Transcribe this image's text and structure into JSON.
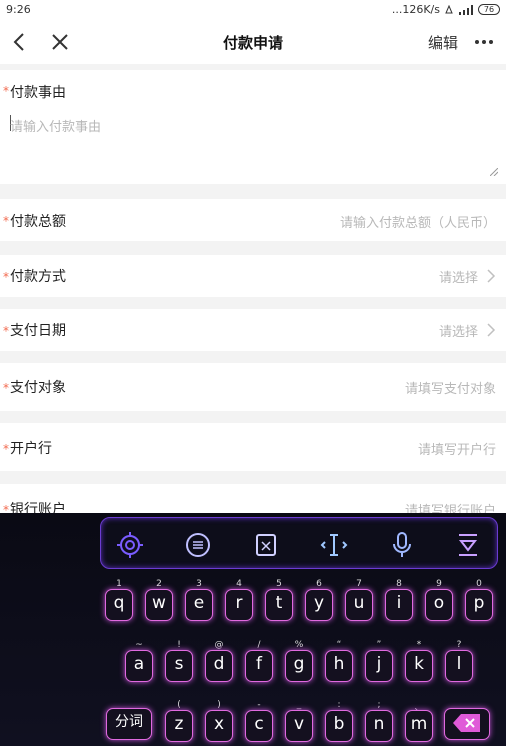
{
  "status_bar": {
    "time": "9:26",
    "speed": "...126K/s",
    "battery": "76"
  },
  "nav": {
    "title": "付款申请",
    "edit_label": "编辑",
    "back_icon": "back-arrow-icon",
    "close_icon": "close-icon",
    "more_icon": "more-icon"
  },
  "form": {
    "reason": {
      "label": "付款事由",
      "placeholder": "请输入付款事由"
    },
    "amount": {
      "label": "付款总额",
      "placeholder": "请输入付款总额（人民币）"
    },
    "method": {
      "label": "付款方式",
      "placeholder": "请选择"
    },
    "date": {
      "label": "支付日期",
      "placeholder": "请选择"
    },
    "target": {
      "label": "支付对象",
      "placeholder": "请填写支付对象"
    },
    "bank": {
      "label": "开户行",
      "placeholder": "请填写开户行"
    },
    "account": {
      "label": "银行账户",
      "placeholder": "请填写银行账户"
    }
  },
  "keyboard": {
    "toolbar": [
      "settings-icon",
      "chat-icon",
      "clipboard-icon",
      "cursor-icon",
      "mic-icon",
      "hide-keyboard-icon"
    ],
    "row1": [
      {
        "k": "q",
        "h": "1"
      },
      {
        "k": "w",
        "h": "2"
      },
      {
        "k": "e",
        "h": "3"
      },
      {
        "k": "r",
        "h": "4"
      },
      {
        "k": "t",
        "h": "5"
      },
      {
        "k": "y",
        "h": "6"
      },
      {
        "k": "u",
        "h": "7"
      },
      {
        "k": "i",
        "h": "8"
      },
      {
        "k": "o",
        "h": "9"
      },
      {
        "k": "p",
        "h": "0"
      }
    ],
    "row2": [
      {
        "k": "a",
        "h": "~"
      },
      {
        "k": "s",
        "h": "!"
      },
      {
        "k": "d",
        "h": "@"
      },
      {
        "k": "f",
        "h": "/"
      },
      {
        "k": "g",
        "h": "%"
      },
      {
        "k": "h",
        "h": "“"
      },
      {
        "k": "j",
        "h": "”"
      },
      {
        "k": "k",
        "h": "*"
      },
      {
        "k": "l",
        "h": "?"
      }
    ],
    "row3": [
      {
        "k": "z",
        "h": "("
      },
      {
        "k": "x",
        "h": ")"
      },
      {
        "k": "c",
        "h": "-"
      },
      {
        "k": "v",
        "h": "_"
      },
      {
        "k": "b",
        "h": ":"
      },
      {
        "k": "n",
        "h": ";"
      },
      {
        "k": "m",
        "h": "、"
      }
    ],
    "segment_label": "分词",
    "accent": "#e06adf"
  }
}
